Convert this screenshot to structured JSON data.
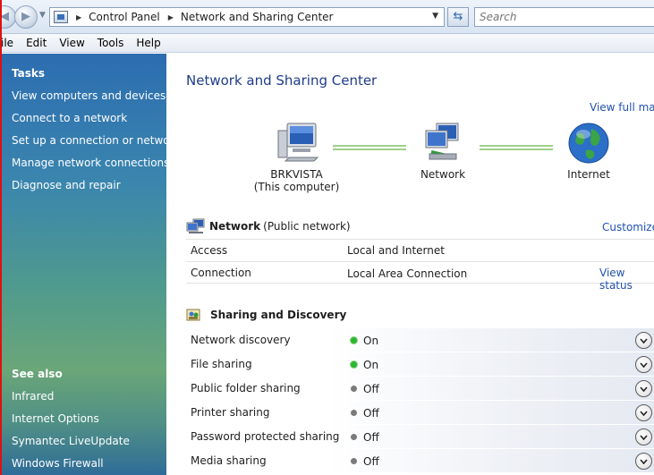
{
  "address": {
    "path": [
      "Control Panel",
      "Network and Sharing Center"
    ],
    "search_placeholder": "Search"
  },
  "menu": [
    "ile",
    "Edit",
    "View",
    "Tools",
    "Help"
  ],
  "tasks": {
    "heading": "Tasks",
    "items": [
      "View computers and devices",
      "Connect to a network",
      "Set up a connection or network",
      "Manage network connections",
      "Diagnose and repair"
    ]
  },
  "see_also": {
    "heading": "See also",
    "items": [
      "Infrared",
      "Internet Options",
      "Symantec LiveUpdate",
      "Windows Firewall"
    ]
  },
  "main": {
    "title": "Network and Sharing Center",
    "view_full_map": "View full map",
    "map": {
      "computer": "BRKVISTA",
      "computer_sub": "(This computer)",
      "network": "Network",
      "internet": "Internet"
    },
    "network_section": {
      "name": "Network",
      "type": "(Public network)",
      "customize": "Customize",
      "rows": [
        {
          "label": "Access",
          "value": "Local and Internet"
        },
        {
          "label": "Connection",
          "value": "Local Area Connection",
          "action": "View status"
        }
      ]
    },
    "sharing_section": {
      "heading": "Sharing and Discovery",
      "rows": [
        {
          "label": "Network discovery",
          "value": "On",
          "state": "on"
        },
        {
          "label": "File sharing",
          "value": "On",
          "state": "on"
        },
        {
          "label": "Public folder sharing",
          "value": "Off",
          "state": "off"
        },
        {
          "label": "Printer sharing",
          "value": "Off",
          "state": "off"
        },
        {
          "label": "Password protected sharing",
          "value": "Off",
          "state": "off"
        },
        {
          "label": "Media sharing",
          "value": "Off",
          "state": "off"
        }
      ]
    }
  },
  "colors": {
    "title": "#1f3c8a",
    "link": "#2050b0",
    "status_on": "#2fb52f",
    "status_off": "#7a7a7a"
  }
}
